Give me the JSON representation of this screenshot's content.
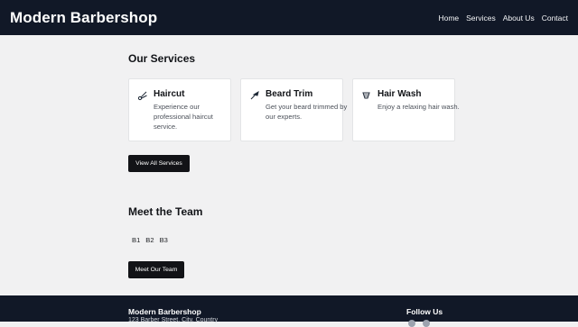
{
  "header": {
    "brand": "Modern Barbershop",
    "nav": [
      "Home",
      "Services",
      "About Us",
      "Contact"
    ]
  },
  "services": {
    "title": "Our Services",
    "items": [
      {
        "name": "Haircut",
        "desc": "Experience our professional haircut service.",
        "icon": "scissors-icon"
      },
      {
        "name": "Beard Trim",
        "desc": "Get your beard trimmed by our experts.",
        "icon": "razor-icon"
      },
      {
        "name": "Hair Wash",
        "desc": "Enjoy a relaxing hair wash.",
        "icon": "hair-wash-icon"
      }
    ],
    "button": "View All Services"
  },
  "team": {
    "title": "Meet the Team",
    "members": [
      "B1",
      "B2",
      "B3"
    ],
    "button": "Meet Our Team"
  },
  "footer": {
    "title": "Modern Barbershop",
    "address": "123 Barber Street, City, Country",
    "follow": "Follow Us",
    "social_icons": [
      "facebook-icon",
      "instagram-icon"
    ]
  },
  "colors": {
    "header_bg": "#111827",
    "page_bg": "#f1f1f2",
    "button_bg": "#121317"
  }
}
